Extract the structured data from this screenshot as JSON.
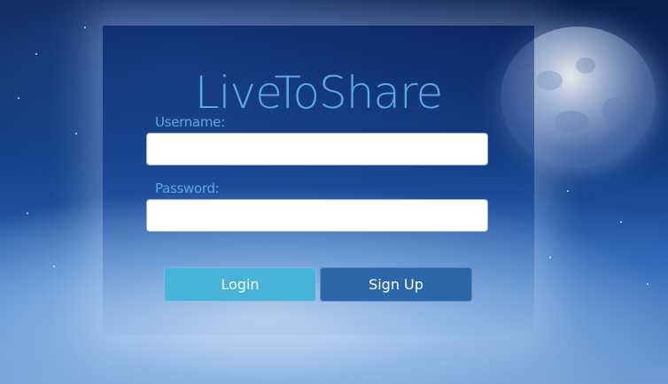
{
  "app": {
    "title": "LiveToShare"
  },
  "form": {
    "username": {
      "label": "Username:",
      "value": "",
      "placeholder": ""
    },
    "password": {
      "label": "Password:",
      "value": "",
      "placeholder": ""
    },
    "login_label": "Login",
    "signup_label": "Sign Up"
  },
  "colors": {
    "title": "#5da9ee",
    "label": "#61a7e8",
    "login_button": "#48b3d9",
    "signup_button": "#2b67a9"
  }
}
